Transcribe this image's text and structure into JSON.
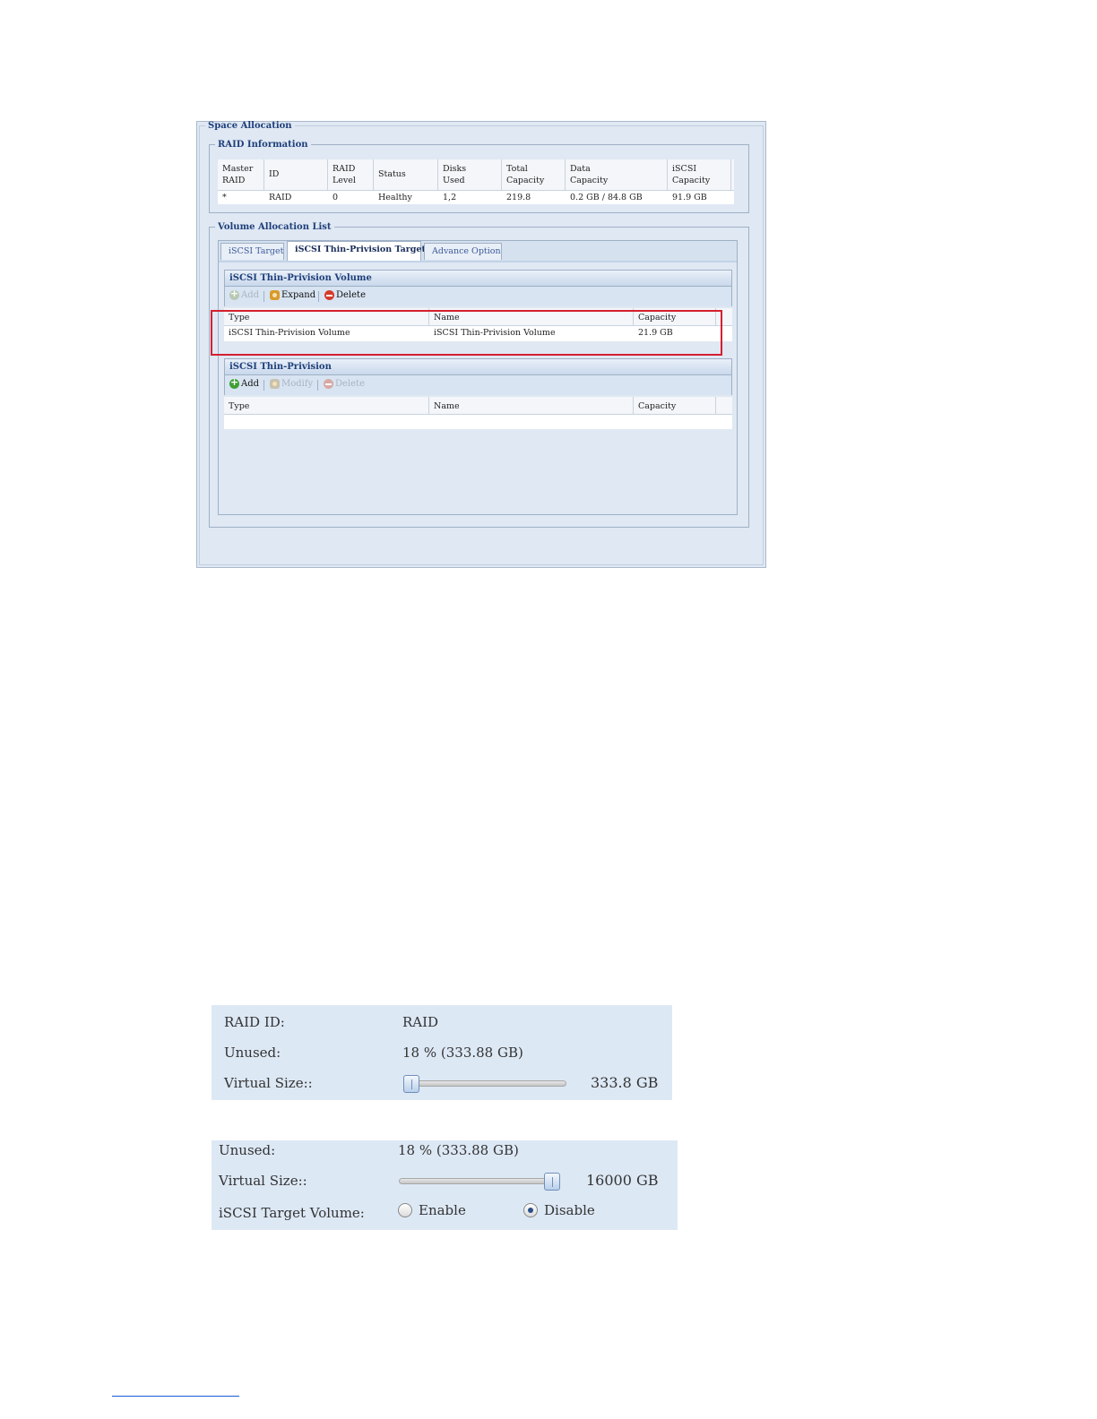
{
  "space_allocation": {
    "legend": "Space Allocation",
    "raid_info": {
      "legend": "RAID Information",
      "headers": [
        [
          "Master",
          "RAID"
        ],
        [
          "ID",
          ""
        ],
        [
          "RAID",
          "Level"
        ],
        [
          "Status",
          ""
        ],
        [
          "Disks",
          "Used"
        ],
        [
          "Total",
          "Capacity"
        ],
        [
          "Data",
          "Capacity"
        ],
        [
          "iSCSI",
          "Capacity"
        ]
      ],
      "row": [
        "*",
        "RAID",
        "0",
        "Healthy",
        "1,2",
        "219.8",
        "0.2 GB / 84.8 GB",
        "91.9 GB"
      ]
    },
    "volume_list": {
      "legend": "Volume Allocation List",
      "tabs": [
        "iSCSI Target",
        "iSCSI Thin-Privision Target",
        "Advance Option"
      ],
      "active_tab": 1,
      "thin_volume": {
        "title": "iSCSI Thin-Privision Volume",
        "toolbar": {
          "add": "Add",
          "expand": "Expand",
          "delete": "Delete"
        },
        "headers": [
          "Type",
          "Name",
          "Capacity"
        ],
        "rows": [
          [
            "iSCSI Thin-Privision Volume",
            "iSCSI Thin-Privision Volume",
            "21.9 GB"
          ]
        ]
      },
      "thin_provision": {
        "title": "iSCSI Thin-Privision",
        "toolbar": {
          "add": "Add",
          "modify": "Modify",
          "delete": "Delete"
        },
        "headers": [
          "Type",
          "Name",
          "Capacity"
        ]
      }
    }
  },
  "raid_form": {
    "raid_id_label": "RAID ID:",
    "raid_id_value": "RAID",
    "unused_label": "Unused:",
    "unused_value": "18 % (333.88 GB)",
    "virtual_size_label": "Virtual Size::",
    "virtual_size_value": "333.8 GB",
    "slider_fraction": 0.0
  },
  "target_form": {
    "unused_label": "Unused:",
    "unused_value": "18 % (333.88 GB)",
    "virtual_size_label": "Virtual Size::",
    "virtual_size_value": "16000 GB",
    "slider_fraction": 1.0,
    "target_volume_label": "iSCSI Target Volume:",
    "enable_label": "Enable",
    "disable_label": "Disable",
    "selected": "Disable"
  },
  "colors": {
    "panel_bg": "#dfe8f3",
    "form_bg": "#dde8f5",
    "highlight": "#d42030",
    "title_blue": "#1f3f7a"
  }
}
